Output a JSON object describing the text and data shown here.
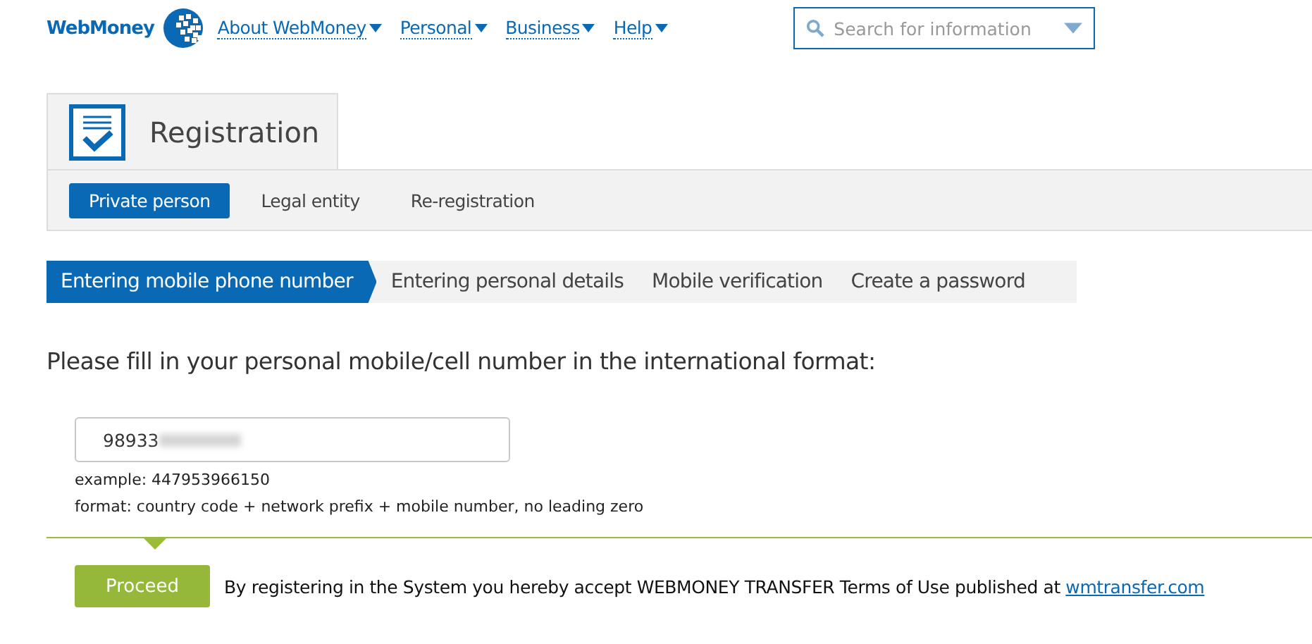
{
  "header": {
    "logo": "WebMoney",
    "nav": [
      {
        "label": "About WebMoney",
        "dropdown": true
      },
      {
        "label": "Personal",
        "dropdown": true
      },
      {
        "label": "Business",
        "dropdown": true
      },
      {
        "label": "Help",
        "dropdown": true
      }
    ],
    "search": {
      "placeholder": "Search for information"
    }
  },
  "page_title": "Registration",
  "subtabs": [
    {
      "label": "Private person",
      "selected": true
    },
    {
      "label": "Legal entity",
      "selected": false
    },
    {
      "label": "Re-registration",
      "selected": false
    }
  ],
  "steps": [
    {
      "label": "Entering mobile phone number",
      "selected": true
    },
    {
      "label": "Entering personal details",
      "selected": false
    },
    {
      "label": "Mobile verification",
      "selected": false
    },
    {
      "label": "Create a password",
      "selected": false
    }
  ],
  "prompt": "Please fill in your personal mobile/cell number in the international format:",
  "phone_field": {
    "value": "98933",
    "blurred": true
  },
  "hints": [
    "example: 447953966150",
    "format: country code + network prefix + mobile number, no leading zero"
  ],
  "footer": {
    "button": "Proceed",
    "terms": "By registering in the System you hereby accept WEBMONEY TRANSFER Terms of Use published at",
    "link": "wmtransfer.com"
  }
}
